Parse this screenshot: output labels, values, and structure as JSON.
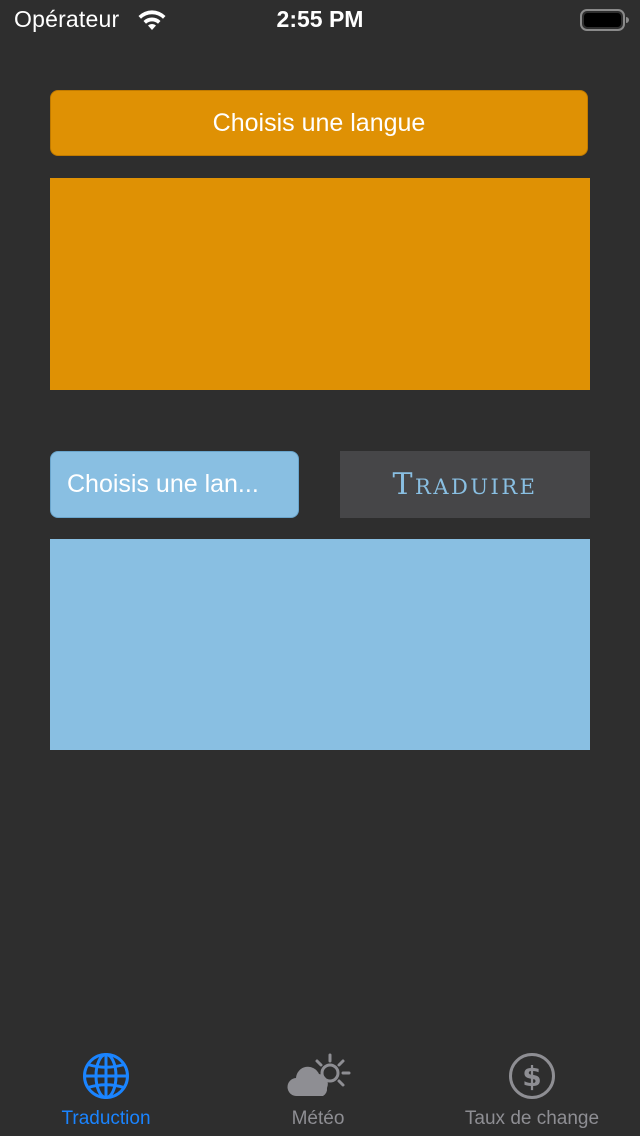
{
  "status_bar": {
    "carrier": "Opérateur",
    "time": "2:55 PM",
    "wifi_icon": "wifi-icon",
    "battery_icon": "battery-icon"
  },
  "source": {
    "language_button_label": "Choisis une langue",
    "text_value": "",
    "color": "#df9104"
  },
  "target": {
    "language_button_label": "Choisis une lan...",
    "text_value": "",
    "color": "#89bfe2"
  },
  "translate_button": {
    "label": "Traduire"
  },
  "tab_bar": {
    "tabs": [
      {
        "label": "Traduction",
        "icon": "globe-icon",
        "active": true
      },
      {
        "label": "Météo",
        "icon": "cloud-sun-icon",
        "active": false
      },
      {
        "label": "Taux de change",
        "icon": "dollar-circle-icon",
        "active": false
      }
    ],
    "active_color": "#1a84ff",
    "inactive_color": "#8e8e93"
  }
}
